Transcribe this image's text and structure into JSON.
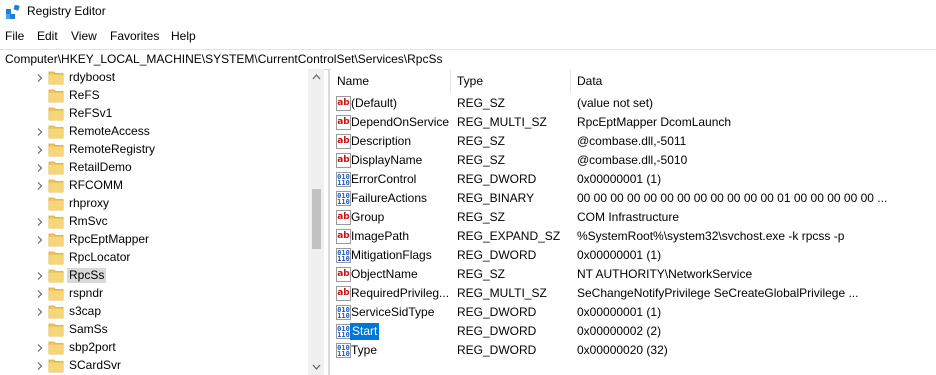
{
  "window": {
    "title": "Registry Editor"
  },
  "menu": [
    "File",
    "Edit",
    "View",
    "Favorites",
    "Help"
  ],
  "address": "Computer\\HKEY_LOCAL_MACHINE\\SYSTEM\\CurrentControlSet\\Services\\RpcSs",
  "tree": {
    "items": [
      {
        "label": "rdyboost",
        "expandable": true
      },
      {
        "label": "ReFS",
        "expandable": false
      },
      {
        "label": "ReFSv1",
        "expandable": false
      },
      {
        "label": "RemoteAccess",
        "expandable": true
      },
      {
        "label": "RemoteRegistry",
        "expandable": true
      },
      {
        "label": "RetailDemo",
        "expandable": true
      },
      {
        "label": "RFCOMM",
        "expandable": true
      },
      {
        "label": "rhproxy",
        "expandable": false
      },
      {
        "label": "RmSvc",
        "expandable": true
      },
      {
        "label": "RpcEptMapper",
        "expandable": true
      },
      {
        "label": "RpcLocator",
        "expandable": false
      },
      {
        "label": "RpcSs",
        "expandable": true,
        "selected": true
      },
      {
        "label": "rspndr",
        "expandable": true
      },
      {
        "label": "s3cap",
        "expandable": true
      },
      {
        "label": "SamSs",
        "expandable": false
      },
      {
        "label": "sbp2port",
        "expandable": true
      },
      {
        "label": "SCardSvr",
        "expandable": true
      }
    ]
  },
  "list": {
    "columns": {
      "name": "Name",
      "type": "Type",
      "data": "Data"
    },
    "rows": [
      {
        "name": "(Default)",
        "type": "REG_SZ",
        "data": "(value not set)",
        "icon": "string-value-icon"
      },
      {
        "name": "DependOnService",
        "type": "REG_MULTI_SZ",
        "data": "RpcEptMapper DcomLaunch",
        "icon": "string-value-icon"
      },
      {
        "name": "Description",
        "type": "REG_SZ",
        "data": "@combase.dll,-5011",
        "icon": "string-value-icon"
      },
      {
        "name": "DisplayName",
        "type": "REG_SZ",
        "data": "@combase.dll,-5010",
        "icon": "string-value-icon"
      },
      {
        "name": "ErrorControl",
        "type": "REG_DWORD",
        "data": "0x00000001 (1)",
        "icon": "binary-value-icon"
      },
      {
        "name": "FailureActions",
        "type": "REG_BINARY",
        "data": "00 00 00 00 00 00 00 00 00 00 00 00 01 00 00 00 00 00 ...",
        "icon": "binary-value-icon"
      },
      {
        "name": "Group",
        "type": "REG_SZ",
        "data": "COM Infrastructure",
        "icon": "string-value-icon"
      },
      {
        "name": "ImagePath",
        "type": "REG_EXPAND_SZ",
        "data": "%SystemRoot%\\system32\\svchost.exe -k rpcss -p",
        "icon": "string-value-icon"
      },
      {
        "name": "MitigationFlags",
        "type": "REG_DWORD",
        "data": "0x00000001 (1)",
        "icon": "binary-value-icon"
      },
      {
        "name": "ObjectName",
        "type": "REG_SZ",
        "data": "NT AUTHORITY\\NetworkService",
        "icon": "string-value-icon"
      },
      {
        "name": "RequiredPrivileg...",
        "type": "REG_MULTI_SZ",
        "data": "SeChangeNotifyPrivilege SeCreateGlobalPrivilege ...",
        "icon": "string-value-icon"
      },
      {
        "name": "ServiceSidType",
        "type": "REG_DWORD",
        "data": "0x00000001 (1)",
        "icon": "binary-value-icon"
      },
      {
        "name": "Start",
        "type": "REG_DWORD",
        "data": "0x00000002 (2)",
        "icon": "binary-value-icon",
        "selected": true
      },
      {
        "name": "Type",
        "type": "REG_DWORD",
        "data": "0x00000020 (32)",
        "icon": "binary-value-icon"
      }
    ]
  },
  "colors": {
    "selection": "#0078d7",
    "folder": "#f0c75a",
    "tree_selection": "#d9d9d9"
  }
}
